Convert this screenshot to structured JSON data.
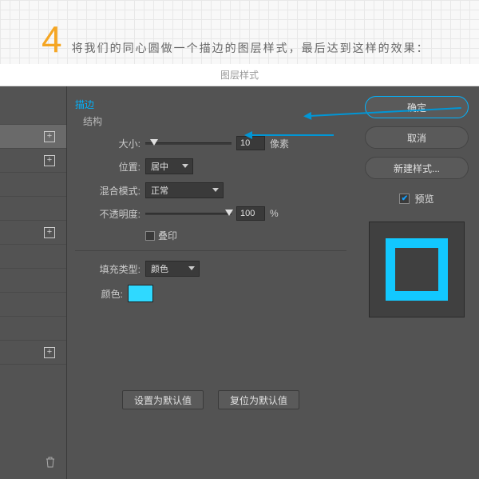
{
  "step": {
    "number": "4",
    "text": "将我们的同心圆做一个描边的图层样式，最后达到这样的效果："
  },
  "window": {
    "title": "图层样式"
  },
  "stroke": {
    "section_title": "描边",
    "structure_label": "结构",
    "size_label": "大小:",
    "size_value": "10",
    "size_unit": "像素",
    "position_label": "位置:",
    "position_value": "居中",
    "blend_label": "混合模式:",
    "blend_value": "正常",
    "opacity_label": "不透明度:",
    "opacity_value": "100",
    "opacity_unit": "%",
    "overprint_label": "叠印",
    "fill_type_label": "填充类型:",
    "fill_type_value": "颜色",
    "color_label": "颜色:",
    "color_value": "#2fd9ff"
  },
  "buttons": {
    "ok": "确定",
    "cancel": "取消",
    "new_style": "新建样式...",
    "preview": "预览",
    "make_default": "设置为默认值",
    "reset_default": "复位为默认值"
  },
  "preview": {
    "border_color": "#12c8ff"
  }
}
